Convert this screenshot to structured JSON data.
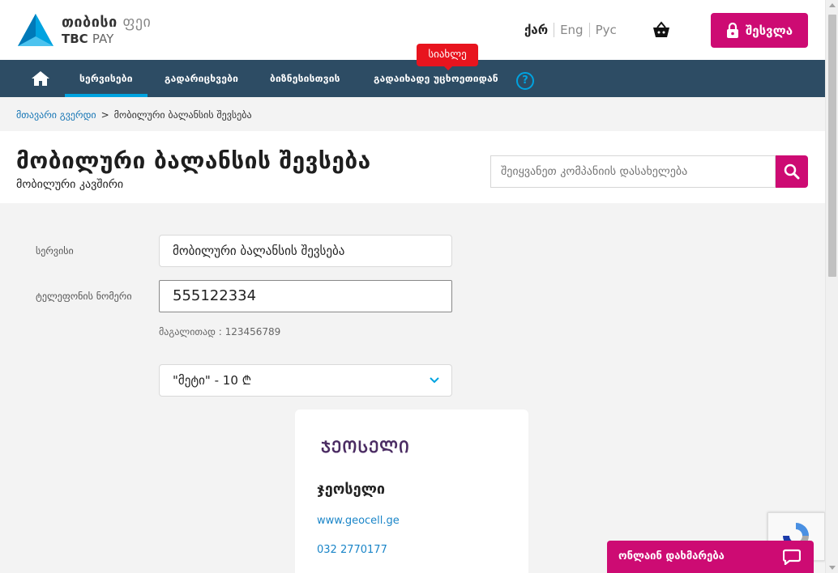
{
  "header": {
    "logo_geo_main": "თიბისი",
    "logo_geo_sub": "ფეი",
    "logo_en_main": "TBC",
    "logo_en_sub": "PAY",
    "languages": [
      "ქარ",
      "Eng",
      "Рус"
    ],
    "login_label": "შესვლა"
  },
  "nav": {
    "items": [
      {
        "label": "სერვისები"
      },
      {
        "label": "გადარიცხვები"
      },
      {
        "label": "ბიზნესისთვის"
      },
      {
        "label": "გადაიხადე უცხოეთიდან"
      }
    ],
    "new_badge": "სიახლე",
    "help_label": "?"
  },
  "breadcrumb": {
    "home": "მთავარი გვერდი",
    "separator": ">",
    "current": "მობილური ბალანსის შევსება"
  },
  "page": {
    "title": "მობილური ბალანსის შევსება",
    "subtitle": "მობილური კავშირი",
    "search_placeholder": "შეიყვანეთ კომპანიის დასახელება"
  },
  "form": {
    "service_label": "სერვისი",
    "service_value": "მობილური ბალანსის შევსება",
    "phone_label": "ტელეფონის ნომერი",
    "phone_value": "555122334",
    "hint": "მაგალითად : 123456789",
    "plan_value": "\"მეტი\" - 10 ₾"
  },
  "provider": {
    "logo_text": "ᲯᲔᲝᲡᲔᲚᲘ",
    "name": "ჯეოსელი",
    "website": "www.geocell.ge",
    "phone": "032 2770177"
  },
  "chat": {
    "label": "ონლაინ დახმარება"
  },
  "colors": {
    "brand_pink": "#cd0b73",
    "nav_bg": "#2d4c64",
    "accent_blue": "#00a3e0",
    "badge_red": "#e8141e",
    "link_blue": "#1a85c8"
  },
  "icons": [
    "tbc-logo-icon",
    "cart-icon",
    "lock-icon",
    "home-icon",
    "help-icon",
    "search-icon",
    "chevron-down-icon",
    "recaptcha-icon",
    "chat-icon"
  ]
}
